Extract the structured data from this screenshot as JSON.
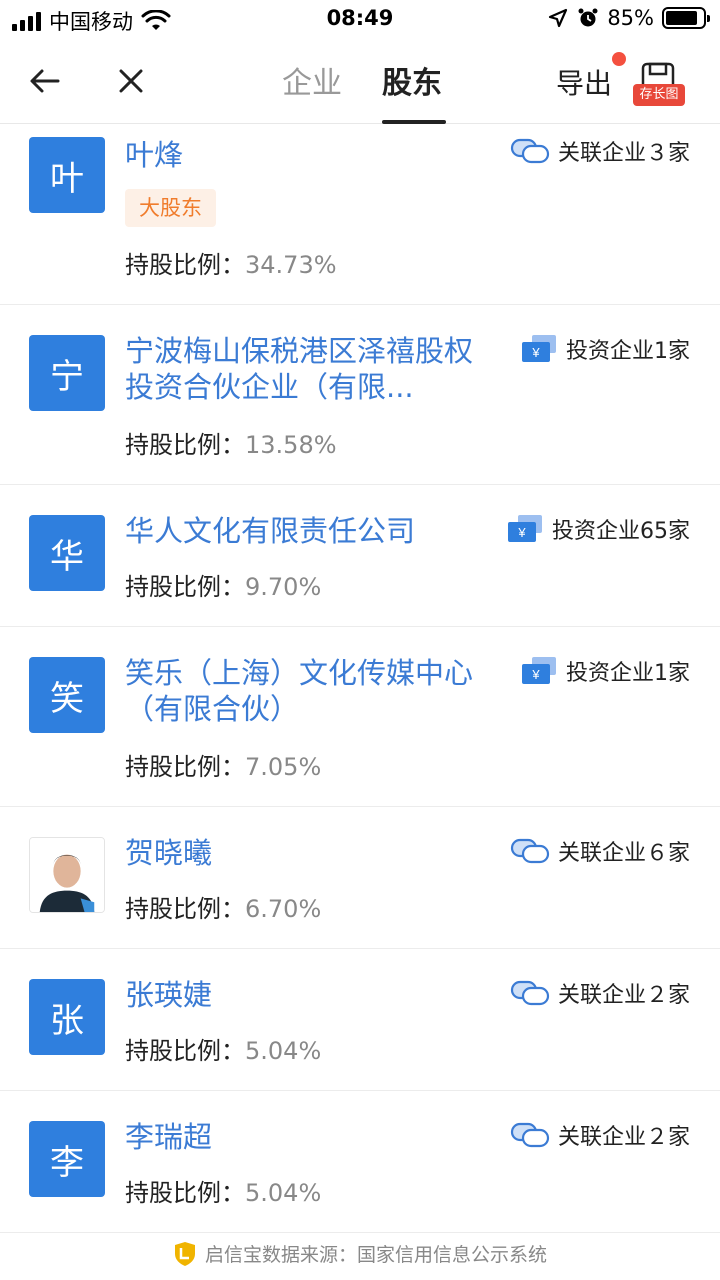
{
  "status_bar": {
    "carrier": "中国移动",
    "time": "08:49",
    "battery": "85%",
    "battery_level": 0.85
  },
  "nav": {
    "tabs": [
      {
        "label": "企业",
        "active": false
      },
      {
        "label": "股东",
        "active": true
      }
    ],
    "export_label": "导出",
    "save_badge": "存长图"
  },
  "ratio_label": "持股比例：",
  "shareholders": [
    {
      "avatar": "叶",
      "name": "叶烽",
      "tag": "大股东",
      "ratio": "34.73%",
      "relation": "关联企业３家",
      "relation_type": "link"
    },
    {
      "avatar": "宁",
      "name": "宁波梅山保税港区泽禧股权投资合伙企业（有限...",
      "ratio": "13.58%",
      "relation": "投资企业1家",
      "relation_type": "invest"
    },
    {
      "avatar": "华",
      "name": "华人文化有限责任公司",
      "ratio": "9.70%",
      "relation": "投资企业65家",
      "relation_type": "invest"
    },
    {
      "avatar": "笑",
      "name": "笑乐（上海）文化传媒中心（有限合伙）",
      "ratio": "7.05%",
      "relation": "投资企业1家",
      "relation_type": "invest"
    },
    {
      "avatar": "",
      "name": "贺晓曦",
      "ratio": "6.70%",
      "relation": "关联企业６家",
      "relation_type": "link"
    },
    {
      "avatar": "张",
      "name": "张瑛婕",
      "ratio": "5.04%",
      "relation": "关联企业２家",
      "relation_type": "link"
    },
    {
      "avatar": "李",
      "name": "李瑞超",
      "ratio": "5.04%",
      "relation": "关联企业２家",
      "relation_type": "link"
    }
  ],
  "footer": "启信宝数据来源：国家信用信息公示系统",
  "colors": {
    "accent": "#2f7fde",
    "link": "#3b7bd4",
    "tag_bg": "#fdf0e6",
    "tag_text": "#f07c2c",
    "badge": "#e8483a"
  }
}
